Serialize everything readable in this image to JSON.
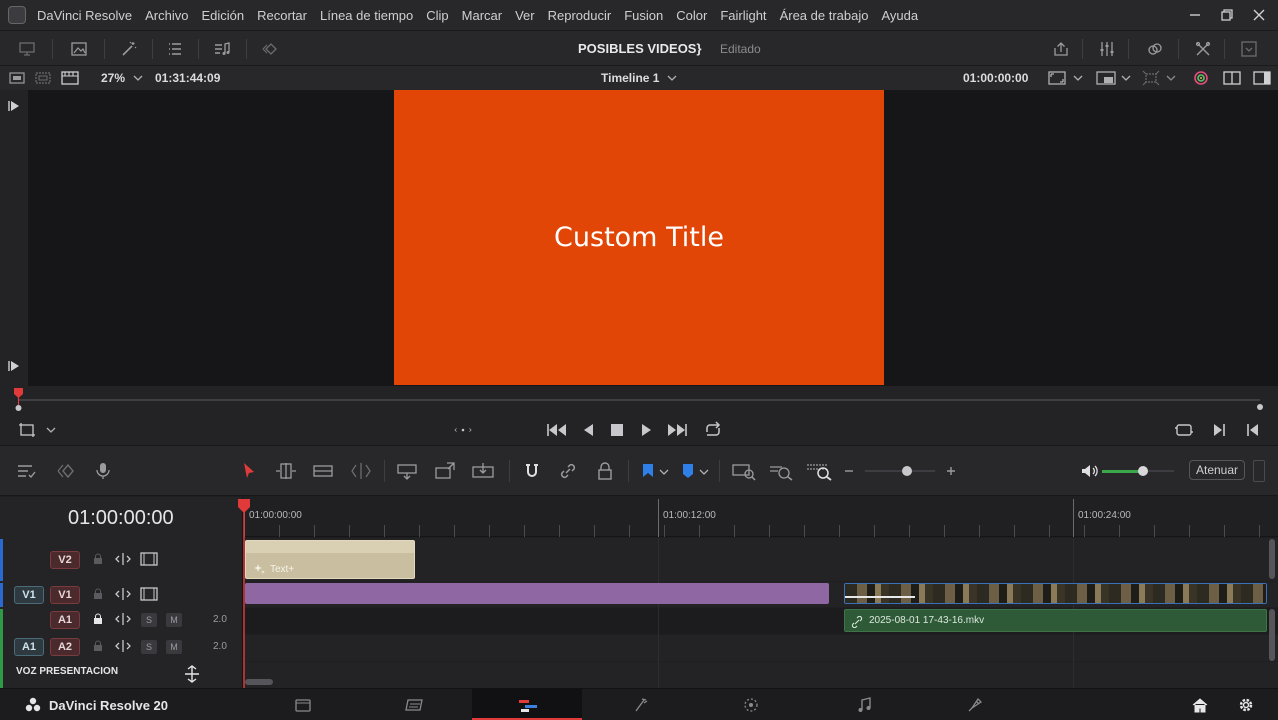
{
  "app": {
    "title": "DaVinci Resolve"
  },
  "menu": [
    "DaVinci Resolve",
    "Archivo",
    "Edición",
    "Recortar",
    "Línea de tiempo",
    "Clip",
    "Marcar",
    "Ver",
    "Reproducir",
    "Fusion",
    "Color",
    "Fairlight",
    "Área de trabajo",
    "Ayuda"
  ],
  "project": {
    "name": "POSIBLES VIDEOS}",
    "status": "Editado"
  },
  "viewer": {
    "zoom": "27%",
    "source_timecode": "01:31:44:09",
    "timeline_name": "Timeline 1",
    "record_timecode": "01:00:00:00",
    "title_text": "Custom Title"
  },
  "toolbar": {
    "attenuate_label": "Atenuar"
  },
  "timeline": {
    "current_timecode": "01:00:00:00",
    "ruler": [
      "01:00:00:00",
      "01:00:12:00",
      "01:00:24:00"
    ],
    "tracks": {
      "v2": "V2",
      "v1_src": "V1",
      "v1": "V1",
      "a1": "A1",
      "a1_src": "A1",
      "a2": "A2",
      "a1_level": "2.0",
      "a2_level": "2.0",
      "s": "S",
      "m": "M"
    },
    "track_name": "VOZ PRESENTACION",
    "clips": {
      "text": "Text+",
      "audio": "2025-08-01 17-43-16.mkv"
    }
  },
  "footer": {
    "product": "DaVinci Resolve 20"
  },
  "colors": {
    "accent_red": "#e03a3a",
    "title_bg": "#e24607",
    "purple_clip": "#8e67a3",
    "audio_clip": "#2f5a38",
    "text_clip": "#c9bfa0"
  }
}
